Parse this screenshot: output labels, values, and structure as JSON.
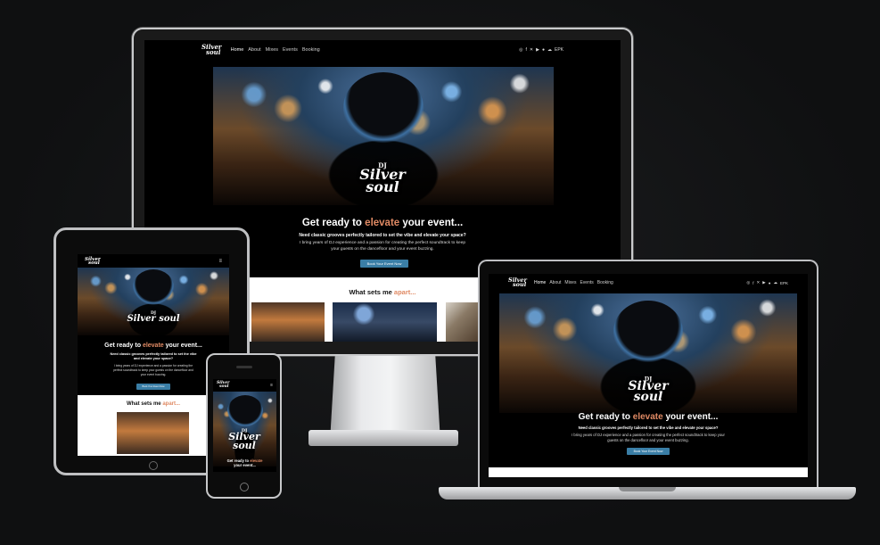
{
  "site": {
    "logo_line1": "Silver",
    "logo_line2": "soul",
    "nav": [
      "Home",
      "About",
      "Mixes",
      "Events",
      "Booking"
    ],
    "socials": [
      "instagram-icon",
      "facebook-icon",
      "x-icon",
      "youtube-icon",
      "spotify-icon",
      "soundcloud-icon",
      "epk-icon"
    ],
    "social_epk_label": "EPK",
    "hero_brand_prefix": "DJ",
    "hero_brand_line1": "Silver",
    "hero_brand_line2": "soul",
    "headline_pre": "Get ready to",
    "headline_accent": "elevate",
    "headline_post": "your event...",
    "subheading": "Need classic grooves perfectly tailored to set the vibe and elevate your space?",
    "body": "I bring years of DJ experience and a passion for creating the perfect soundtrack to keep your guests on the dancefloor and your event buzzing.",
    "cta": "Book Your Event Now",
    "section_title_pre": "What sets me",
    "section_title_accent": "apart..."
  },
  "colors": {
    "accent": "#e08a64",
    "button": "#3a7ea6",
    "background": "#000000",
    "section": "#ffffff"
  }
}
